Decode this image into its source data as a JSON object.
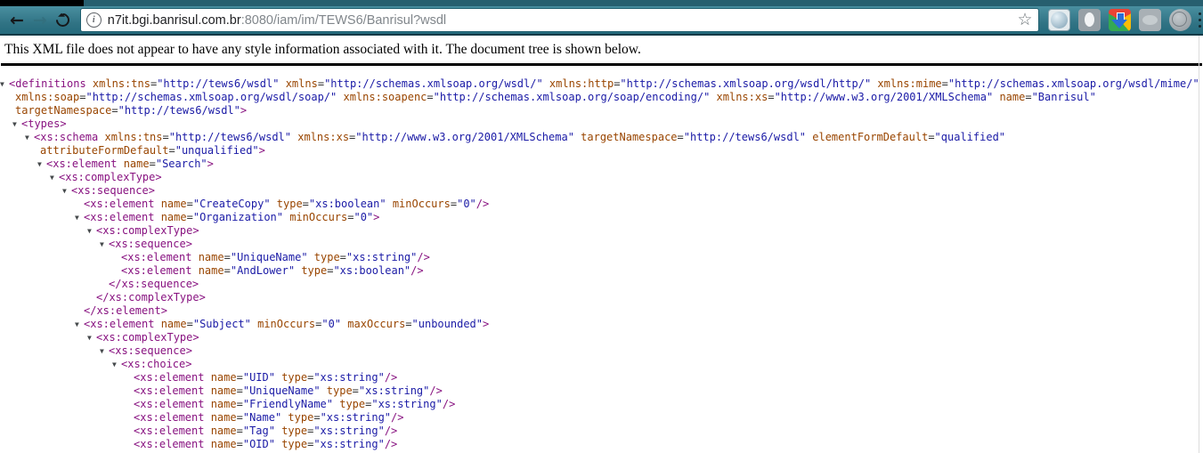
{
  "browser": {
    "url": {
      "host": "n7it.bgi.banrisul.com.br",
      "path": ":8080/iam/im/TEWS6/Banrisul?wsdl"
    },
    "nav": {
      "back_glyph": "←",
      "forward_glyph": "→"
    },
    "star_glyph": "☆",
    "info_glyph": "i",
    "colors": {
      "toolbar_teal_top": "#4a8fa0",
      "toolbar_teal_bottom": "#256b7d",
      "toolbar_border": "#0e3a46",
      "url_host": "#202124",
      "url_path": "#80868b"
    }
  },
  "page": {
    "message": "This XML file does not appear to have any style information associated with it. The document tree is shown below.",
    "xml_colors": {
      "tag": "#881280",
      "attribute": "#994500",
      "value": "#1a1aa6"
    },
    "xml_lines": [
      {
        "ind": 10,
        "arrow": true,
        "parts": [
          [
            "tag",
            "<definitions"
          ],
          [
            "att",
            " xmlns:tns"
          ],
          [
            "eq",
            "="
          ],
          [
            "val",
            "\"http://tews6/wsdl\""
          ],
          [
            "att",
            " xmlns"
          ],
          [
            "eq",
            "="
          ],
          [
            "val",
            "\"http://schemas.xmlsoap.org/wsdl/\""
          ],
          [
            "att",
            " xmlns:http"
          ],
          [
            "eq",
            "="
          ],
          [
            "val",
            "\"http://schemas.xmlsoap.org/wsdl/http/\""
          ],
          [
            "att",
            " xmlns:mime"
          ],
          [
            "eq",
            "="
          ],
          [
            "val",
            "\"http://schemas.xmlsoap.org/wsdl/mime/\""
          ]
        ]
      },
      {
        "ind": 17,
        "arrow": false,
        "parts": [
          [
            "att",
            "xmlns:soap"
          ],
          [
            "eq",
            "="
          ],
          [
            "val",
            "\"http://schemas.xmlsoap.org/wsdl/soap/\""
          ],
          [
            "att",
            " xmlns:soapenc"
          ],
          [
            "eq",
            "="
          ],
          [
            "val",
            "\"http://schemas.xmlsoap.org/soap/encoding/\""
          ],
          [
            "att",
            " xmlns:xs"
          ],
          [
            "eq",
            "="
          ],
          [
            "val",
            "\"http://www.w3.org/2001/XMLSchema\""
          ],
          [
            "att",
            " name"
          ],
          [
            "eq",
            "="
          ],
          [
            "val",
            "\"Banrisul\""
          ]
        ]
      },
      {
        "ind": 17,
        "arrow": false,
        "parts": [
          [
            "att",
            "targetNamespace"
          ],
          [
            "eq",
            "="
          ],
          [
            "val",
            "\"http://tews6/wsdl\""
          ],
          [
            "tag",
            ">"
          ]
        ]
      },
      {
        "ind": 24,
        "arrow": true,
        "parts": [
          [
            "tag",
            "<types>"
          ]
        ]
      },
      {
        "ind": 38,
        "arrow": true,
        "parts": [
          [
            "tag",
            "<xs:schema"
          ],
          [
            "att",
            " xmlns:tns"
          ],
          [
            "eq",
            "="
          ],
          [
            "val",
            "\"http://tews6/wsdl\""
          ],
          [
            "att",
            " xmlns:xs"
          ],
          [
            "eq",
            "="
          ],
          [
            "val",
            "\"http://www.w3.org/2001/XMLSchema\""
          ],
          [
            "att",
            " targetNamespace"
          ],
          [
            "eq",
            "="
          ],
          [
            "val",
            "\"http://tews6/wsdl\""
          ],
          [
            "att",
            " elementFormDefault"
          ],
          [
            "eq",
            "="
          ],
          [
            "val",
            "\"qualified\""
          ]
        ]
      },
      {
        "ind": 45,
        "arrow": false,
        "parts": [
          [
            "att",
            "attributeFormDefault"
          ],
          [
            "eq",
            "="
          ],
          [
            "val",
            "\"unqualified\""
          ],
          [
            "tag",
            ">"
          ]
        ]
      },
      {
        "ind": 52,
        "arrow": true,
        "parts": [
          [
            "tag",
            "<xs:element"
          ],
          [
            "att",
            " name"
          ],
          [
            "eq",
            "="
          ],
          [
            "val",
            "\"Search\""
          ],
          [
            "tag",
            ">"
          ]
        ]
      },
      {
        "ind": 66,
        "arrow": true,
        "parts": [
          [
            "tag",
            "<xs:complexType>"
          ]
        ]
      },
      {
        "ind": 80,
        "arrow": true,
        "parts": [
          [
            "tag",
            "<xs:sequence>"
          ]
        ]
      },
      {
        "ind": 94,
        "arrow": false,
        "parts": [
          [
            "tag",
            "<xs:element"
          ],
          [
            "att",
            " name"
          ],
          [
            "eq",
            "="
          ],
          [
            "val",
            "\"CreateCopy\""
          ],
          [
            "att",
            " type"
          ],
          [
            "eq",
            "="
          ],
          [
            "val",
            "\"xs:boolean\""
          ],
          [
            "att",
            " minOccurs"
          ],
          [
            "eq",
            "="
          ],
          [
            "val",
            "\"0\""
          ],
          [
            "tag",
            "/>"
          ]
        ]
      },
      {
        "ind": 94,
        "arrow": true,
        "parts": [
          [
            "tag",
            "<xs:element"
          ],
          [
            "att",
            " name"
          ],
          [
            "eq",
            "="
          ],
          [
            "val",
            "\"Organization\""
          ],
          [
            "att",
            " minOccurs"
          ],
          [
            "eq",
            "="
          ],
          [
            "val",
            "\"0\""
          ],
          [
            "tag",
            ">"
          ]
        ]
      },
      {
        "ind": 108,
        "arrow": true,
        "parts": [
          [
            "tag",
            "<xs:complexType>"
          ]
        ]
      },
      {
        "ind": 122,
        "arrow": true,
        "parts": [
          [
            "tag",
            "<xs:sequence>"
          ]
        ]
      },
      {
        "ind": 136,
        "arrow": false,
        "parts": [
          [
            "tag",
            "<xs:element"
          ],
          [
            "att",
            " name"
          ],
          [
            "eq",
            "="
          ],
          [
            "val",
            "\"UniqueName\""
          ],
          [
            "att",
            " type"
          ],
          [
            "eq",
            "="
          ],
          [
            "val",
            "\"xs:string\""
          ],
          [
            "tag",
            "/>"
          ]
        ]
      },
      {
        "ind": 136,
        "arrow": false,
        "parts": [
          [
            "tag",
            "<xs:element"
          ],
          [
            "att",
            " name"
          ],
          [
            "eq",
            "="
          ],
          [
            "val",
            "\"AndLower\""
          ],
          [
            "att",
            " type"
          ],
          [
            "eq",
            "="
          ],
          [
            "val",
            "\"xs:boolean\""
          ],
          [
            "tag",
            "/>"
          ]
        ]
      },
      {
        "ind": 122,
        "arrow": false,
        "parts": [
          [
            "tag",
            "</xs:sequence>"
          ]
        ]
      },
      {
        "ind": 108,
        "arrow": false,
        "parts": [
          [
            "tag",
            "</xs:complexType>"
          ]
        ]
      },
      {
        "ind": 94,
        "arrow": false,
        "parts": [
          [
            "tag",
            "</xs:element>"
          ]
        ]
      },
      {
        "ind": 94,
        "arrow": true,
        "parts": [
          [
            "tag",
            "<xs:element"
          ],
          [
            "att",
            " name"
          ],
          [
            "eq",
            "="
          ],
          [
            "val",
            "\"Subject\""
          ],
          [
            "att",
            " minOccurs"
          ],
          [
            "eq",
            "="
          ],
          [
            "val",
            "\"0\""
          ],
          [
            "att",
            " maxOccurs"
          ],
          [
            "eq",
            "="
          ],
          [
            "val",
            "\"unbounded\""
          ],
          [
            "tag",
            ">"
          ]
        ]
      },
      {
        "ind": 108,
        "arrow": true,
        "parts": [
          [
            "tag",
            "<xs:complexType>"
          ]
        ]
      },
      {
        "ind": 122,
        "arrow": true,
        "parts": [
          [
            "tag",
            "<xs:sequence>"
          ]
        ]
      },
      {
        "ind": 136,
        "arrow": true,
        "parts": [
          [
            "tag",
            "<xs:choice>"
          ]
        ]
      },
      {
        "ind": 150,
        "arrow": false,
        "parts": [
          [
            "tag",
            "<xs:element"
          ],
          [
            "att",
            " name"
          ],
          [
            "eq",
            "="
          ],
          [
            "val",
            "\"UID\""
          ],
          [
            "att",
            " type"
          ],
          [
            "eq",
            "="
          ],
          [
            "val",
            "\"xs:string\""
          ],
          [
            "tag",
            "/>"
          ]
        ]
      },
      {
        "ind": 150,
        "arrow": false,
        "parts": [
          [
            "tag",
            "<xs:element"
          ],
          [
            "att",
            " name"
          ],
          [
            "eq",
            "="
          ],
          [
            "val",
            "\"UniqueName\""
          ],
          [
            "att",
            " type"
          ],
          [
            "eq",
            "="
          ],
          [
            "val",
            "\"xs:string\""
          ],
          [
            "tag",
            "/>"
          ]
        ]
      },
      {
        "ind": 150,
        "arrow": false,
        "parts": [
          [
            "tag",
            "<xs:element"
          ],
          [
            "att",
            " name"
          ],
          [
            "eq",
            "="
          ],
          [
            "val",
            "\"FriendlyName\""
          ],
          [
            "att",
            " type"
          ],
          [
            "eq",
            "="
          ],
          [
            "val",
            "\"xs:string\""
          ],
          [
            "tag",
            "/>"
          ]
        ]
      },
      {
        "ind": 150,
        "arrow": false,
        "parts": [
          [
            "tag",
            "<xs:element"
          ],
          [
            "att",
            " name"
          ],
          [
            "eq",
            "="
          ],
          [
            "val",
            "\"Name\""
          ],
          [
            "att",
            " type"
          ],
          [
            "eq",
            "="
          ],
          [
            "val",
            "\"xs:string\""
          ],
          [
            "tag",
            "/>"
          ]
        ]
      },
      {
        "ind": 150,
        "arrow": false,
        "parts": [
          [
            "tag",
            "<xs:element"
          ],
          [
            "att",
            " name"
          ],
          [
            "eq",
            "="
          ],
          [
            "val",
            "\"Tag\""
          ],
          [
            "att",
            " type"
          ],
          [
            "eq",
            "="
          ],
          [
            "val",
            "\"xs:string\""
          ],
          [
            "tag",
            "/>"
          ]
        ]
      },
      {
        "ind": 150,
        "arrow": false,
        "parts": [
          [
            "tag",
            "<xs:element"
          ],
          [
            "att",
            " name"
          ],
          [
            "eq",
            "="
          ],
          [
            "val",
            "\"OID\""
          ],
          [
            "att",
            " type"
          ],
          [
            "eq",
            "="
          ],
          [
            "val",
            "\"xs:string\""
          ],
          [
            "tag",
            "/>"
          ]
        ]
      }
    ]
  }
}
